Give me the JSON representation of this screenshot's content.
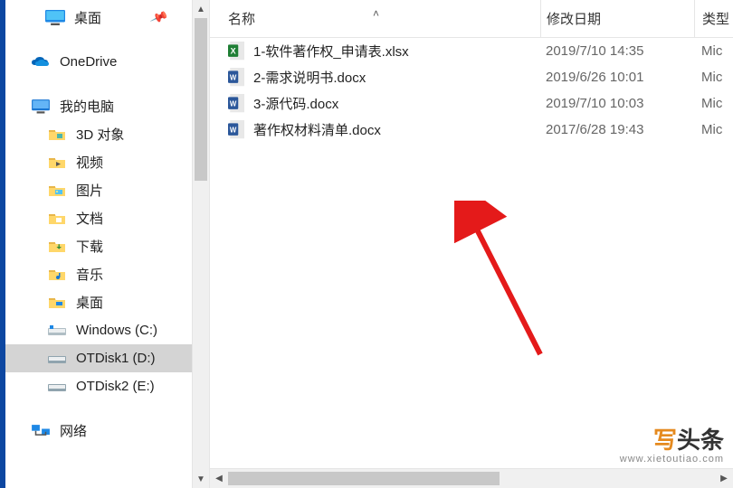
{
  "sidebar": {
    "pinned_desktop": "桌面",
    "onedrive": "OneDrive",
    "this_pc": "我的电脑",
    "items": [
      {
        "label": "3D 对象"
      },
      {
        "label": "视频"
      },
      {
        "label": "图片"
      },
      {
        "label": "文档"
      },
      {
        "label": "下载"
      },
      {
        "label": "音乐"
      },
      {
        "label": "桌面"
      },
      {
        "label": "Windows (C:)"
      },
      {
        "label": "OTDisk1 (D:)"
      },
      {
        "label": "OTDisk2 (E:)"
      }
    ],
    "network": "网络"
  },
  "columns": {
    "name": "名称",
    "modified": "修改日期",
    "type": "类型"
  },
  "files": [
    {
      "icon": "excel",
      "name": "1-软件著作权_申请表.xlsx",
      "modified": "2019/7/10 14:35",
      "type": "Mic"
    },
    {
      "icon": "word",
      "name": "2-需求说明书.docx",
      "modified": "2019/6/26 10:01",
      "type": "Mic"
    },
    {
      "icon": "word",
      "name": "3-源代码.docx",
      "modified": "2019/7/10 10:03",
      "type": "Mic"
    },
    {
      "icon": "word",
      "name": "著作权材料清单.docx",
      "modified": "2017/6/28 19:43",
      "type": "Mic"
    }
  ],
  "watermark": {
    "char1": "写",
    "char2": "头条",
    "url": "www.xietoutiao.com"
  }
}
